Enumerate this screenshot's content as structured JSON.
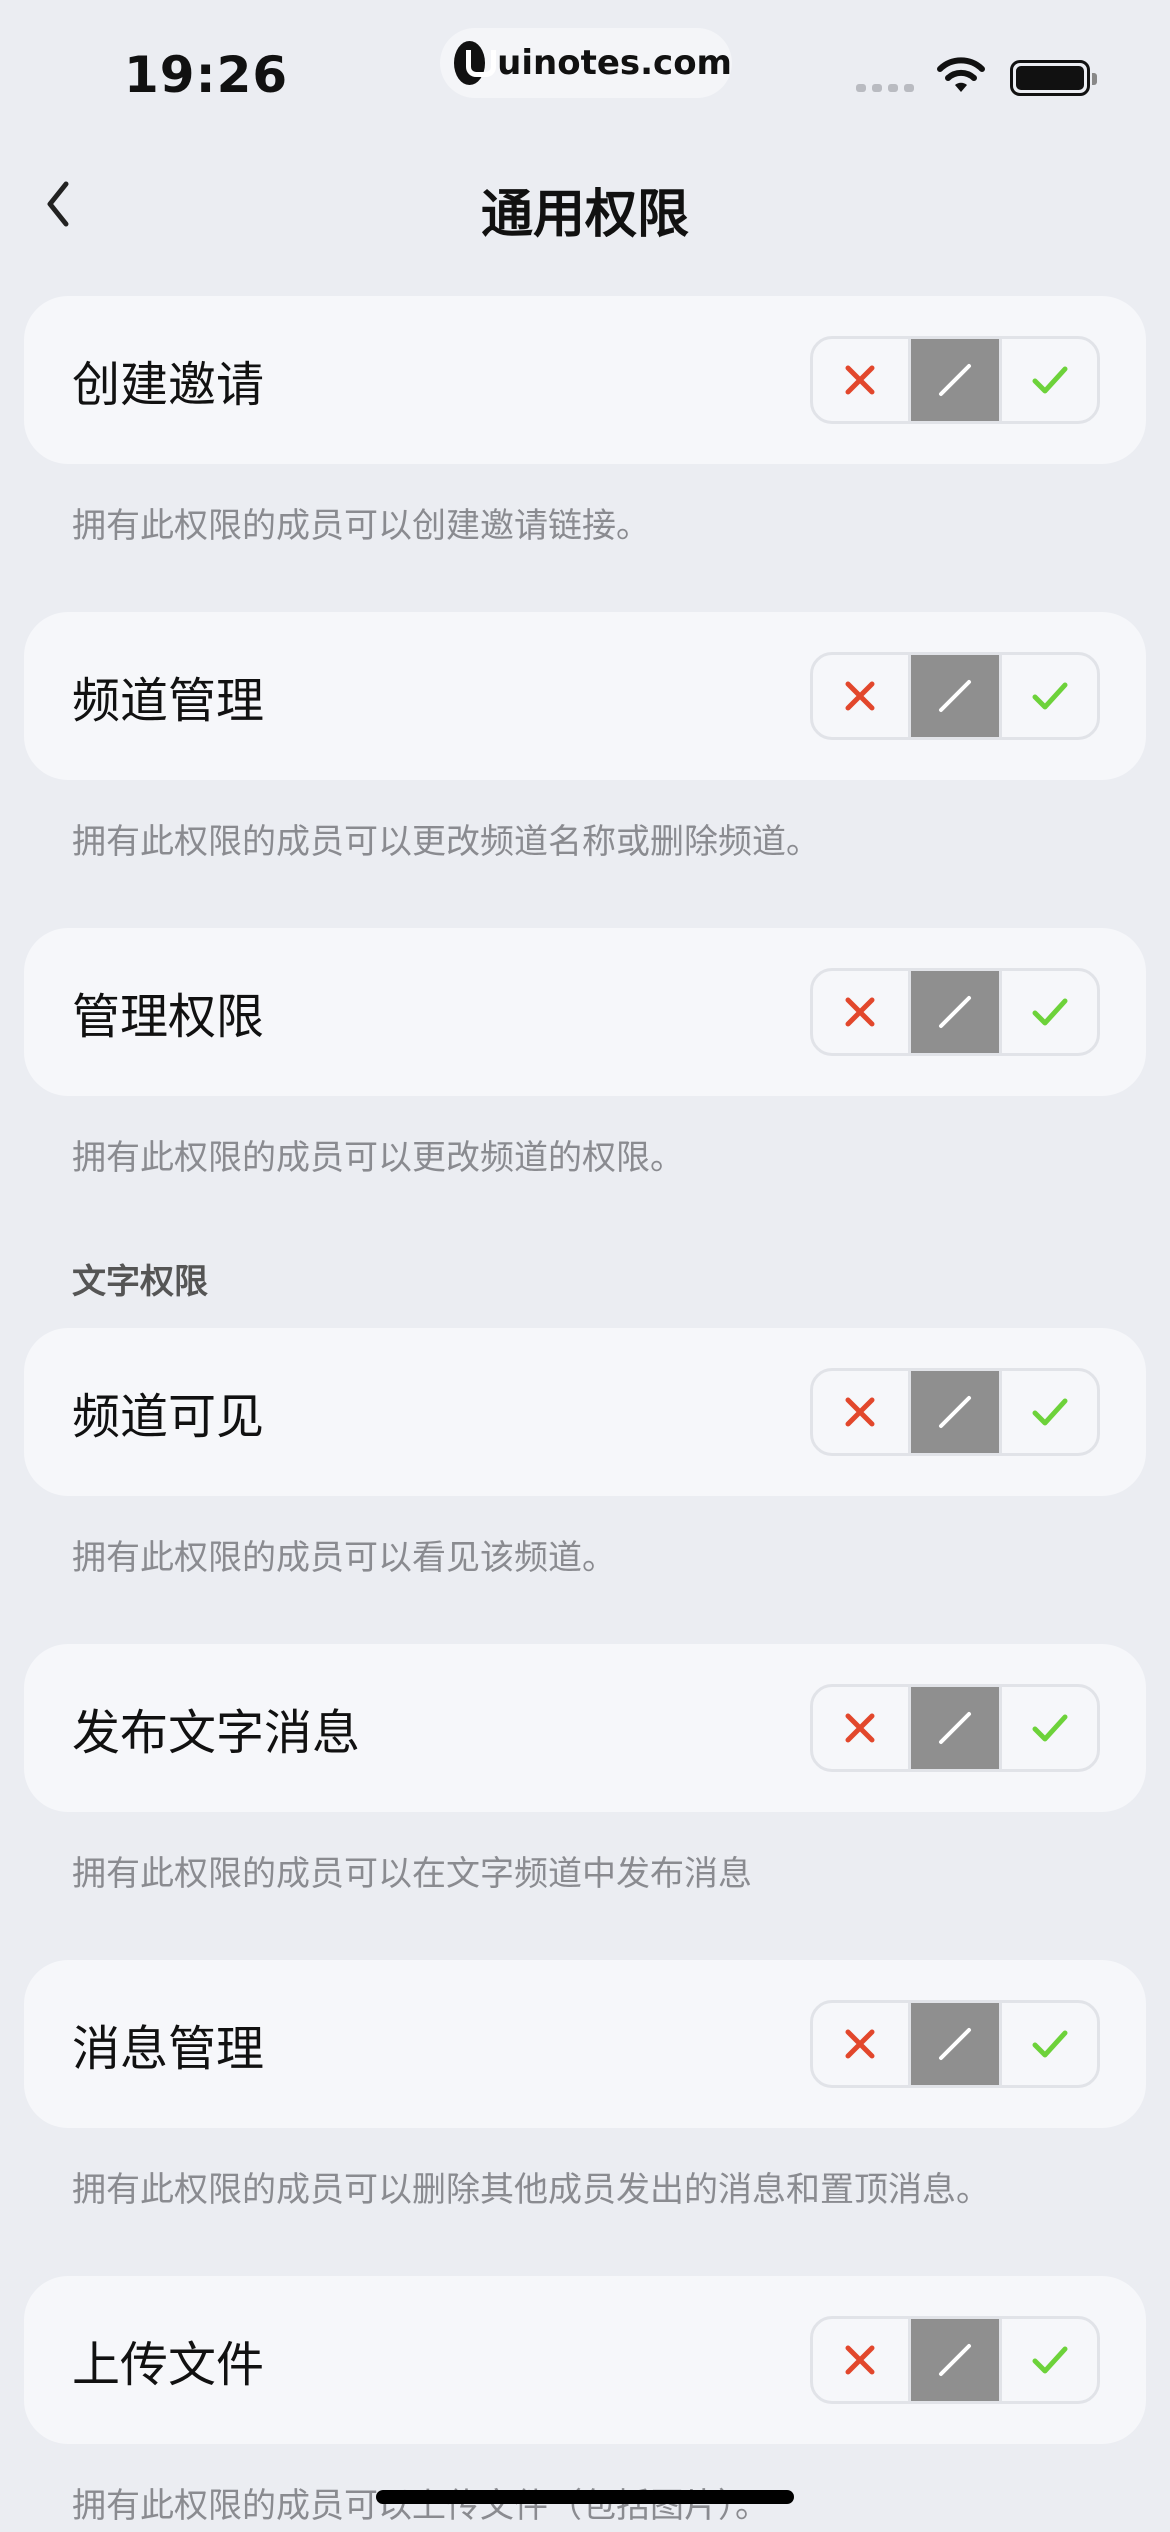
{
  "status_bar": {
    "time": "19:26",
    "watermark": "uinotes.com"
  },
  "nav": {
    "title": "通用权限"
  },
  "section_text": {
    "title": "文字权限"
  },
  "colors": {
    "deny": "#E2472C",
    "neutral_bg": "#8F8F8F",
    "allow": "#6DD23A"
  },
  "icons": {
    "deny": "x-icon",
    "neutral": "slash-icon",
    "allow": "check-icon",
    "back": "chevron-left-icon"
  },
  "permissions": [
    {
      "title": "创建邀请",
      "description": "拥有此权限的成员可以创建邀请链接。",
      "state": "neutral"
    },
    {
      "title": "频道管理",
      "description": "拥有此权限的成员可以更改频道名称或删除频道。",
      "state": "neutral"
    },
    {
      "title": "管理权限",
      "description": "拥有此权限的成员可以更改频道的权限。",
      "state": "neutral"
    },
    {
      "title": "频道可见",
      "description": "拥有此权限的成员可以看见该频道。",
      "state": "neutral"
    },
    {
      "title": "发布文字消息",
      "description": "拥有此权限的成员可以在文字频道中发布消息",
      "state": "neutral"
    },
    {
      "title": "消息管理",
      "description": "拥有此权限的成员可以删除其他成员发出的消息和置顶消息。",
      "state": "neutral"
    },
    {
      "title": "上传文件",
      "description": "拥有此权限的成员可以上传文件（包括图片）。",
      "state": "neutral"
    }
  ]
}
